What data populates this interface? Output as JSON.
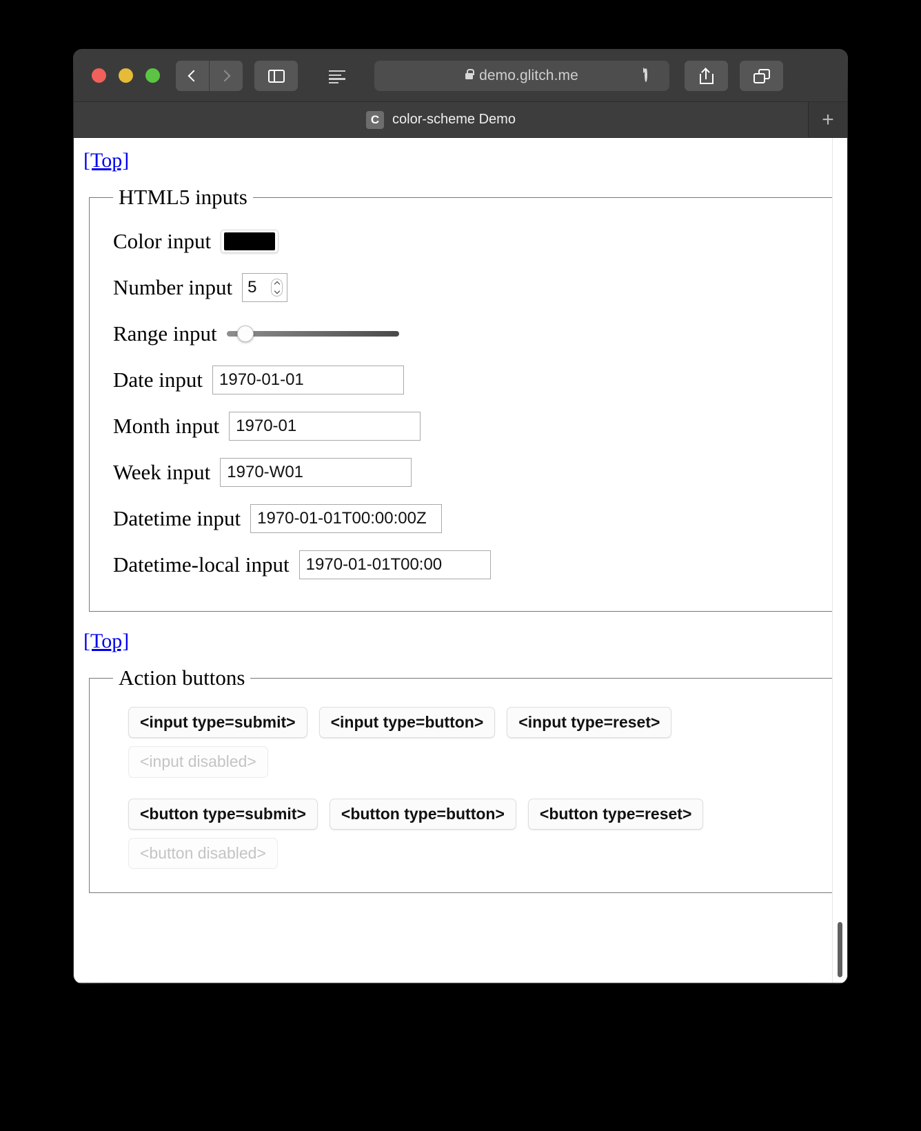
{
  "browser": {
    "url": "demo.glitch.me",
    "lock_icon": "lock-icon",
    "reload_icon": "reload-icon",
    "back_icon": "chevron-left-icon",
    "forward_icon": "chevron-right-icon",
    "sidebar_icon": "sidebar-icon",
    "reader_icon": "reader-view-icon",
    "share_icon": "share-icon",
    "tabs_icon": "tab-overview-icon",
    "new_tab_label": "+",
    "tab": {
      "favicon_letter": "C",
      "title": "color-scheme Demo"
    }
  },
  "page": {
    "top_link_1": "[Top]",
    "top_link_2": "[Top]",
    "html5_fieldset": {
      "legend": "HTML5 inputs",
      "fields": [
        {
          "label": "Color input",
          "type": "color",
          "value": "#000000"
        },
        {
          "label": "Number input",
          "type": "number",
          "value": "5"
        },
        {
          "label": "Range input",
          "type": "range",
          "value": "10"
        },
        {
          "label": "Date input",
          "type": "date",
          "value": "1970-01-01"
        },
        {
          "label": "Month input",
          "type": "month",
          "value": "1970-01"
        },
        {
          "label": "Week input",
          "type": "week",
          "value": "1970-W01"
        },
        {
          "label": "Datetime input",
          "type": "datetime",
          "value": "1970-01-01T00:00:00Z"
        },
        {
          "label": "Datetime-local input",
          "type": "datetime-local",
          "value": "1970-01-01T00:00"
        }
      ]
    },
    "action_fieldset": {
      "legend": "Action buttons",
      "input_buttons": [
        {
          "label": "<input type=submit>",
          "disabled": false
        },
        {
          "label": "<input type=button>",
          "disabled": false
        },
        {
          "label": "<input type=reset>",
          "disabled": false
        }
      ],
      "input_disabled": [
        {
          "label": "<input disabled>",
          "disabled": true
        }
      ],
      "button_buttons": [
        {
          "label": "<button type=submit>",
          "disabled": false
        },
        {
          "label": "<button type=button>",
          "disabled": false
        },
        {
          "label": "<button type=reset>",
          "disabled": false
        }
      ],
      "button_disabled": [
        {
          "label": "<button disabled>",
          "disabled": true
        }
      ]
    }
  },
  "colors": {
    "link": "#0000ee",
    "chrome": "#3b3b3b",
    "page_bg": "#ffffff",
    "color_input_value": "#000000"
  }
}
